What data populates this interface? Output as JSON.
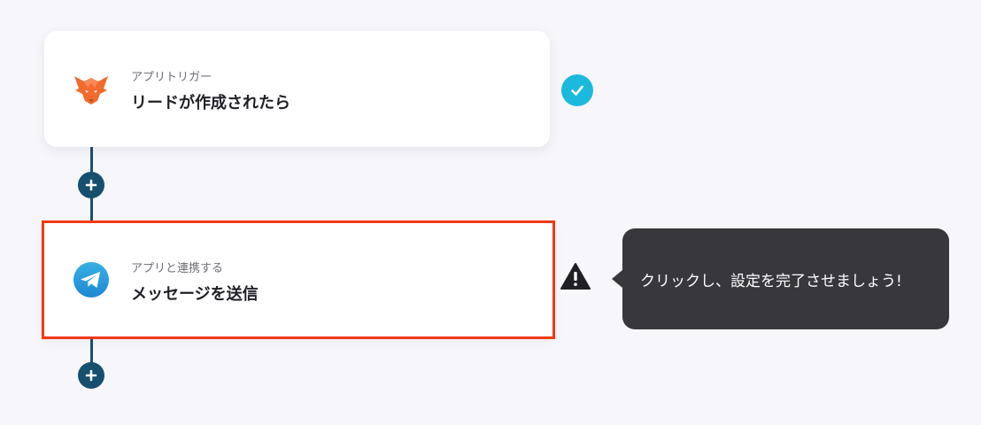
{
  "flow": {
    "steps": [
      {
        "type_label": "アプリトリガー",
        "title": "リードが作成されたら",
        "app_icon": "fox-icon",
        "status": "complete"
      },
      {
        "type_label": "アプリと連携する",
        "title": "メッセージを送信",
        "app_icon": "telegram-icon",
        "status": "warning"
      }
    ],
    "tooltip_text": "クリックし、設定を完了させましょう!"
  },
  "colors": {
    "background": "#f7f6fa",
    "connector": "#1b4f6e",
    "add_button": "#16506f",
    "check_badge": "#1cb9de",
    "highlight_border": "#f03a0f",
    "tooltip_bg": "#38373c",
    "fox_orange": "#f26a2e",
    "telegram_blue": "#2aa3df"
  }
}
